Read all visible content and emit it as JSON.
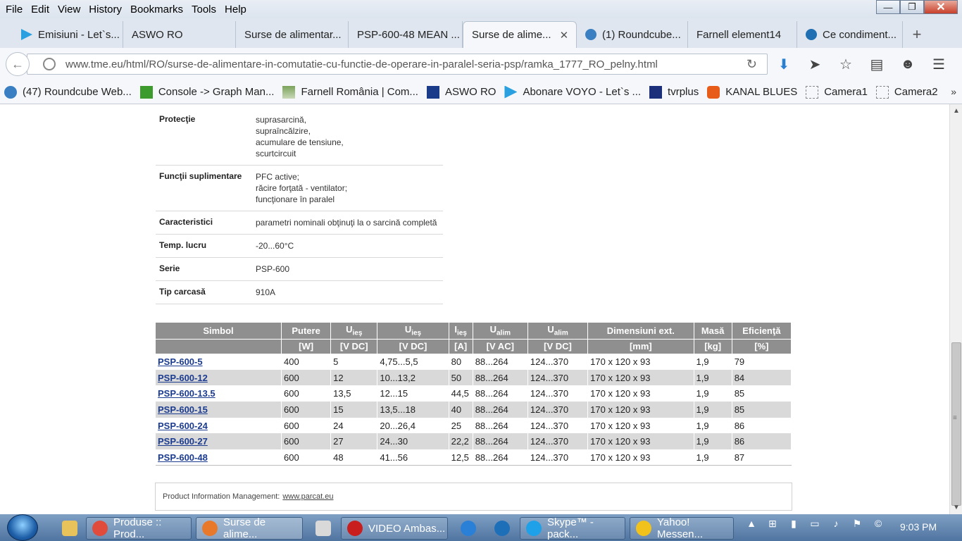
{
  "menu": [
    "File",
    "Edit",
    "View",
    "History",
    "Bookmarks",
    "Tools",
    "Help"
  ],
  "window_controls": {
    "minimize": "—",
    "maximize": "❐",
    "close": "✕"
  },
  "tabs": [
    {
      "label": "Emisiuni - Let`s...",
      "icon_color": "#2aa0e0"
    },
    {
      "label": "ASWO RO",
      "icon_color": ""
    },
    {
      "label": "Surse de alimentar...",
      "icon_color": ""
    },
    {
      "label": "PSP-600-48 MEAN ...",
      "icon_color": ""
    },
    {
      "label": "Surse de alime...",
      "icon_color": "",
      "active": true
    },
    {
      "label": "(1) Roundcube...",
      "icon_color": "#3a7fc1"
    },
    {
      "label": "Farnell element14",
      "icon_color": ""
    },
    {
      "label": "Ce condiment...",
      "icon_color": "#1f6fb2"
    }
  ],
  "new_tab": "+",
  "url": "www.tme.eu/html/RO/surse-de-alimentare-in-comutatie-cu-functie-de-operare-in-paralel-seria-psp/ramka_1777_RO_pelny.html",
  "bookmarks": [
    {
      "label": "(47) Roundcube Web...",
      "color": "#3a7fc1"
    },
    {
      "label": "Console -> Graph Man...",
      "color": "#3c9b2c"
    },
    {
      "label": "Farnell România | Com...",
      "color": "#7aa35a"
    },
    {
      "label": "ASWO RO",
      "color": "#1a3b8a"
    },
    {
      "label": "Abonare VOYO - Let`s ...",
      "color": "#2aa0e0"
    },
    {
      "label": "tvrplus",
      "color": "#1b2f7a"
    },
    {
      "label": "KANAL BLUES",
      "color": "#e85c1a"
    },
    {
      "label": "Camera1",
      "color": ""
    },
    {
      "label": "Camera2",
      "color": ""
    }
  ],
  "bookmarks_more": "»",
  "params": [
    {
      "key": "Protecţie",
      "lines": [
        "suprasarcină,",
        "supraîncălzire,",
        "acumulare de tensiune,",
        "scurtcircuit"
      ]
    },
    {
      "key": "Funcţii suplimentare",
      "lines": [
        "PFC active;",
        "răcire forţată - ventilator;",
        "funcţionare în paralel"
      ]
    },
    {
      "key": "Caracteristici",
      "lines": [
        "parametri nominali obţinuţi la o sarcină completă"
      ]
    },
    {
      "key": "Temp. lucru",
      "lines": [
        "-20...60°C"
      ]
    },
    {
      "key": "Serie",
      "lines": [
        "PSP-600"
      ]
    },
    {
      "key": "Tip carcasă",
      "lines": [
        "910A"
      ]
    }
  ],
  "table": {
    "headers": [
      "Simbol",
      "Putere",
      "Uieş",
      "Uieş",
      "Iieş",
      "Ualim",
      "Ualim",
      "Dimensiuni ext.",
      "Masă",
      "Eficienţă"
    ],
    "header_parts": [
      {
        "main": "Simbol",
        "sub": ""
      },
      {
        "main": "Putere",
        "sub": ""
      },
      {
        "main": "U",
        "sub": "ieş"
      },
      {
        "main": "U",
        "sub": "ieş"
      },
      {
        "main": "I",
        "sub": "ieş"
      },
      {
        "main": "U",
        "sub": "alim"
      },
      {
        "main": "U",
        "sub": "alim"
      },
      {
        "main": "Dimensiuni ext.",
        "sub": ""
      },
      {
        "main": "Masă",
        "sub": ""
      },
      {
        "main": "Eficienţă",
        "sub": ""
      }
    ],
    "units": [
      "",
      "[W]",
      "[V DC]",
      "[V DC]",
      "[A]",
      "[V AC]",
      "[V DC]",
      "[mm]",
      "[kg]",
      "[%]"
    ],
    "rows": [
      [
        "PSP-600-5",
        "400",
        "5",
        "4,75...5,5",
        "80",
        "88...264",
        "124...370",
        "170 x 120 x 93",
        "1,9",
        "79"
      ],
      [
        "PSP-600-12",
        "600",
        "12",
        "10...13,2",
        "50",
        "88...264",
        "124...370",
        "170 x 120 x 93",
        "1,9",
        "84"
      ],
      [
        "PSP-600-13.5",
        "600",
        "13,5",
        "12...15",
        "44,5",
        "88...264",
        "124...370",
        "170 x 120 x 93",
        "1,9",
        "85"
      ],
      [
        "PSP-600-15",
        "600",
        "15",
        "13,5...18",
        "40",
        "88...264",
        "124...370",
        "170 x 120 x 93",
        "1,9",
        "85"
      ],
      [
        "PSP-600-24",
        "600",
        "24",
        "20...26,4",
        "25",
        "88...264",
        "124...370",
        "170 x 120 x 93",
        "1,9",
        "86"
      ],
      [
        "PSP-600-27",
        "600",
        "27",
        "24...30",
        "22,2",
        "88...264",
        "124...370",
        "170 x 120 x 93",
        "1,9",
        "86"
      ],
      [
        "PSP-600-48",
        "600",
        "48",
        "41...56",
        "12,5",
        "88...264",
        "124...370",
        "170 x 120 x 93",
        "1,9",
        "87"
      ]
    ]
  },
  "footer": {
    "text": "Product Information Management:",
    "link": "www.parcat.eu"
  },
  "taskbar": {
    "items": [
      {
        "label": "",
        "color": "#e8c25a"
      },
      {
        "label": "Produse :: Prod...",
        "color": "#e04b3b"
      },
      {
        "label": "Surse de alime...",
        "color": "#e8792a",
        "active": true
      },
      {
        "label": "",
        "color": "#d9d9d9"
      },
      {
        "label": "VIDEO Ambas...",
        "color": "#c81e1e"
      },
      {
        "label": "",
        "color": "#2a7fd6"
      },
      {
        "label": "",
        "color": "#1d6fb8"
      },
      {
        "label": "Skype™ - pack...",
        "color": "#1ea1e8"
      },
      {
        "label": "Yahoo! Messen...",
        "color": "#f2c21c"
      }
    ],
    "clock": "9:03 PM"
  },
  "accent_link_color": "#1b3b8f",
  "table_header_color": "#8f8f8f"
}
